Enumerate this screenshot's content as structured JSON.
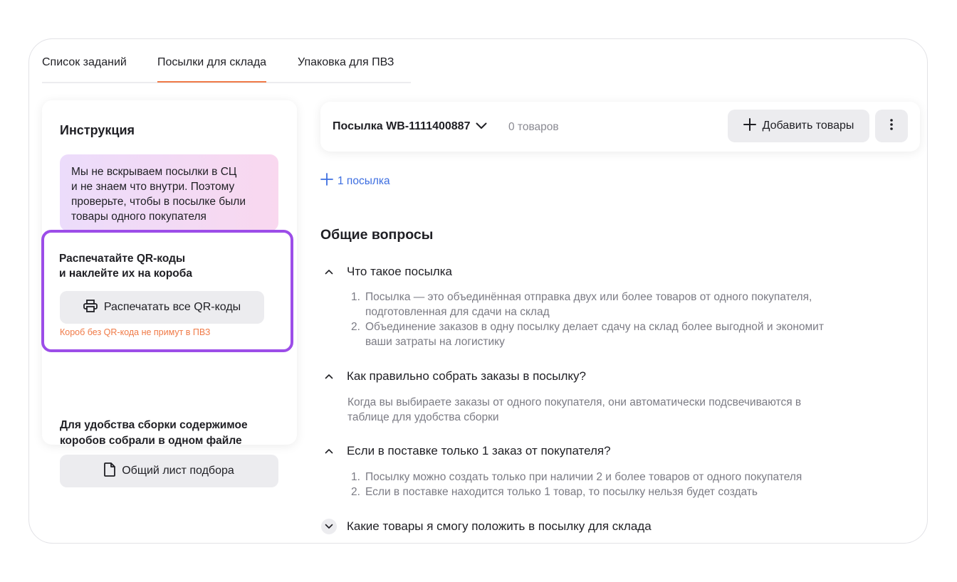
{
  "tabs": [
    {
      "label": "Список заданий",
      "active": false
    },
    {
      "label": "Посылки для склада",
      "active": true
    },
    {
      "label": "Упаковка для ПВЗ",
      "active": false
    }
  ],
  "instruction": {
    "title": "Инструкция",
    "note": "Мы не вскрываем посылки в СЦ\nи не знаем что внутри. Поэтому\nпроверьте, чтобы в посылке были\nтовары одного покупателя",
    "qr_title": "Распечатайте QR-коды\nи наклейте их на короба",
    "qr_button": "Распечатать все QR-коды",
    "qr_warning": "Короб без QR-кода не примут в ПВЗ",
    "pick_title": "Для удобства сборки содержимое\nкоробов собрали в одном файле",
    "pick_button": "Общий лист подбора"
  },
  "parcel": {
    "name": "Посылка WB-1111400887",
    "count": "0 товаров",
    "add_button": "Добавить товары",
    "add_parcel": "1 посылка"
  },
  "faq": {
    "title": "Общие вопросы",
    "items": [
      {
        "question": "Что такое посылка",
        "answers": [
          {
            "num": "1.",
            "text": "Посылка — это объединённая отправка двух или более товаров от одного покупателя,\nподготовленная для сдачи на склад"
          },
          {
            "num": "2.",
            "text": "Объединение заказов в одну посылку делает сдачу на склад более выгодной и экономит\nваши затраты на логистику"
          }
        ]
      },
      {
        "question": "Как правильно собрать заказы в посылку?",
        "answer": "Когда вы выбираете заказы от одного покупателя, они автоматически подсвечиваются в\nтаблице для удобства сборки"
      },
      {
        "question": "Если в поставке только 1 заказ от покупателя?",
        "answers": [
          {
            "num": "1.",
            "text": "Посылку можно создать только при наличии 2 и более товаров от одного покупателя"
          },
          {
            "num": "2.",
            "text": "Если в поставке находится только 1 товар, то посылку нельзя будет создать"
          }
        ]
      },
      {
        "question": "Какие товары я смогу положить в посылку для склада"
      }
    ]
  },
  "colors": {
    "accent_orange": "#f07a47",
    "highlight_purple": "#9c4de8",
    "link_blue": "#3d6ee0"
  }
}
